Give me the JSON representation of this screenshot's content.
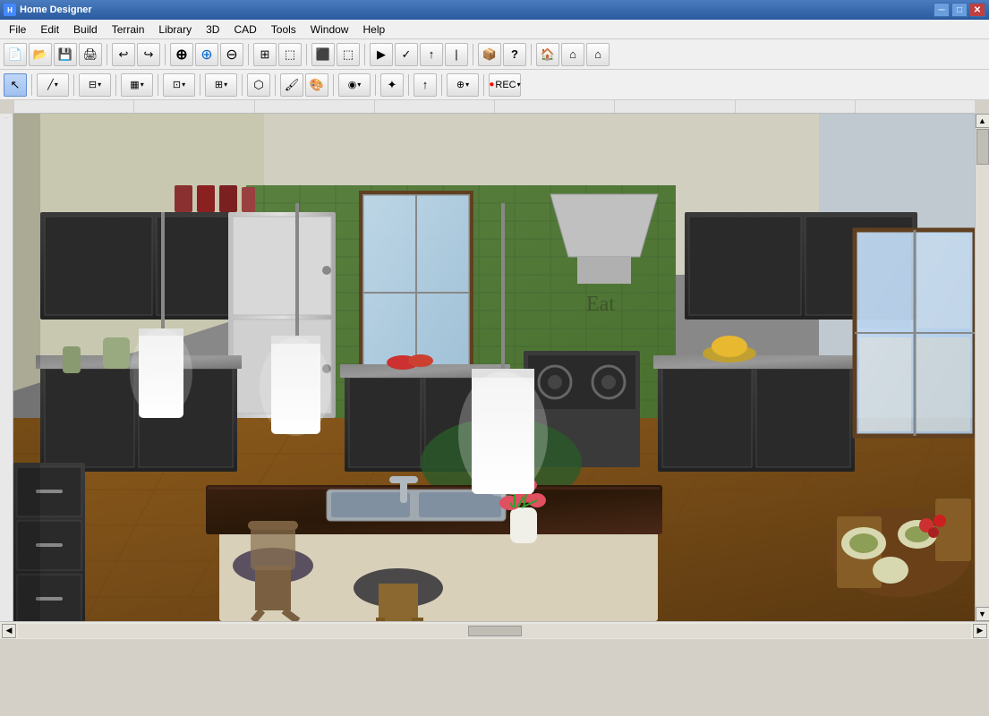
{
  "app": {
    "title": "Home Designer",
    "icon": "H"
  },
  "title_bar": {
    "title": "Home Designer",
    "controls": {
      "minimize": "─",
      "maximize": "□",
      "close": "✕"
    }
  },
  "menu": {
    "items": [
      "File",
      "Edit",
      "Build",
      "Terrain",
      "Library",
      "3D",
      "CAD",
      "Tools",
      "Window",
      "Help"
    ]
  },
  "toolbar1": {
    "buttons": [
      {
        "name": "new",
        "icon": "📄",
        "label": "New"
      },
      {
        "name": "open",
        "icon": "📂",
        "label": "Open"
      },
      {
        "name": "save",
        "icon": "💾",
        "label": "Save"
      },
      {
        "name": "print",
        "icon": "🖨",
        "label": "Print"
      },
      {
        "name": "sep1",
        "type": "sep"
      },
      {
        "name": "undo",
        "icon": "↩",
        "label": "Undo"
      },
      {
        "name": "redo",
        "icon": "↪",
        "label": "Redo"
      },
      {
        "name": "sep2",
        "type": "sep"
      },
      {
        "name": "zoom-in",
        "icon": "⊕",
        "label": "Zoom In"
      },
      {
        "name": "zoom-in2",
        "icon": "⊕",
        "label": "Zoom In 2"
      },
      {
        "name": "zoom-out",
        "icon": "⊖",
        "label": "Zoom Out"
      },
      {
        "name": "sep3",
        "type": "sep"
      },
      {
        "name": "fit",
        "icon": "⊞",
        "label": "Fit"
      },
      {
        "name": "select-all",
        "icon": "⬚",
        "label": "Select All"
      },
      {
        "name": "sep4",
        "type": "sep"
      },
      {
        "name": "tool1",
        "icon": "⊞",
        "label": "Tool 1"
      },
      {
        "name": "tool2",
        "icon": "⬛",
        "label": "Tool 2"
      },
      {
        "name": "sep5",
        "type": "sep"
      },
      {
        "name": "tool3",
        "icon": "✒",
        "label": "Tool 3"
      },
      {
        "name": "tool4",
        "icon": "▲",
        "label": "Tool 4"
      },
      {
        "name": "sep6",
        "type": "sep"
      },
      {
        "name": "help",
        "icon": "?",
        "label": "Help"
      },
      {
        "name": "sep7",
        "type": "sep"
      },
      {
        "name": "house1",
        "icon": "🏠",
        "label": "House 1"
      },
      {
        "name": "house2",
        "icon": "⌂",
        "label": "House 2"
      },
      {
        "name": "house3",
        "icon": "⌂",
        "label": "House 3"
      }
    ]
  },
  "toolbar2": {
    "buttons": [
      {
        "name": "select",
        "icon": "↖",
        "label": "Select",
        "active": true
      },
      {
        "name": "sep1",
        "type": "sep"
      },
      {
        "name": "draw-line",
        "icon": "╱",
        "label": "Draw Line"
      },
      {
        "name": "sep2",
        "type": "sep"
      },
      {
        "name": "wall-tool",
        "icon": "⊟",
        "label": "Wall Tool"
      },
      {
        "name": "sep3",
        "type": "sep"
      },
      {
        "name": "cabinet",
        "icon": "▦",
        "label": "Cabinet"
      },
      {
        "name": "sep4",
        "type": "sep"
      },
      {
        "name": "furniture",
        "icon": "⊡",
        "label": "Furniture"
      },
      {
        "name": "sep5",
        "type": "sep"
      },
      {
        "name": "room",
        "icon": "⊞",
        "label": "Room"
      },
      {
        "name": "sep6",
        "type": "sep"
      },
      {
        "name": "terrain",
        "icon": "⬡",
        "label": "Terrain"
      },
      {
        "name": "sep7",
        "type": "sep"
      },
      {
        "name": "paint",
        "icon": "🖌",
        "label": "Paint"
      },
      {
        "name": "colors",
        "icon": "🎨",
        "label": "Colors"
      },
      {
        "name": "sep8",
        "type": "sep"
      },
      {
        "name": "material",
        "icon": "◉",
        "label": "Material"
      },
      {
        "name": "sep9",
        "type": "sep"
      },
      {
        "name": "symbol",
        "icon": "✦",
        "label": "Symbol"
      },
      {
        "name": "sep10",
        "type": "sep"
      },
      {
        "name": "arrow-up",
        "icon": "↑",
        "label": "Arrow Up"
      },
      {
        "name": "sep11",
        "type": "sep"
      },
      {
        "name": "move",
        "icon": "⊕",
        "label": "Move"
      },
      {
        "name": "sep12",
        "type": "sep"
      },
      {
        "name": "record",
        "icon": "⏺",
        "label": "Record"
      }
    ]
  },
  "statusbar": {
    "scroll_left": "◀",
    "scroll_right": "▶",
    "scroll_thumb_position": "center"
  },
  "canvas": {
    "description": "3D Kitchen view - Home Designer software",
    "background_color": "#7a6030"
  }
}
